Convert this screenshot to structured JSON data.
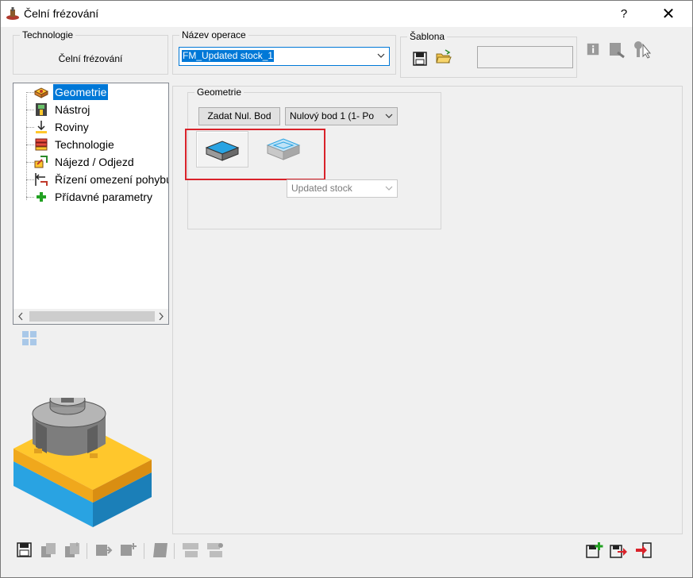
{
  "window": {
    "title": "Čelní frézování"
  },
  "titlebar": {
    "help": "?",
    "close": "✕"
  },
  "technology": {
    "label": "Technologie",
    "value": "Čelní frézování"
  },
  "operation_name": {
    "label": "Název operace",
    "value": "FM_Updated stock_1"
  },
  "template": {
    "label": "Šablona",
    "field_value": ""
  },
  "tree": {
    "items": [
      {
        "label": "Geometrie",
        "icon": "geometry-icon",
        "selected": true
      },
      {
        "label": "Nástroj",
        "icon": "tool-icon"
      },
      {
        "label": "Roviny",
        "icon": "planes-icon"
      },
      {
        "label": "Technologie",
        "icon": "technology-icon"
      },
      {
        "label": "Nájezd / Odjezd",
        "icon": "approach-icon"
      },
      {
        "label": "Řízení omezení pohybu",
        "icon": "motion-limit-icon"
      },
      {
        "label": "Přídavné parametry",
        "icon": "plus-icon"
      }
    ]
  },
  "geometry_panel": {
    "label": "Geometrie",
    "set_zero_button": "Zadat Nul. Bod",
    "zero_point_select": "Nulový bod 1 (1- Po",
    "stock_select": "Updated stock"
  },
  "colors": {
    "accent": "#0078d7",
    "highlight_border": "#d9222a",
    "stock_blue": "#29a3e2",
    "stock_yellow": "#ffc72c"
  }
}
